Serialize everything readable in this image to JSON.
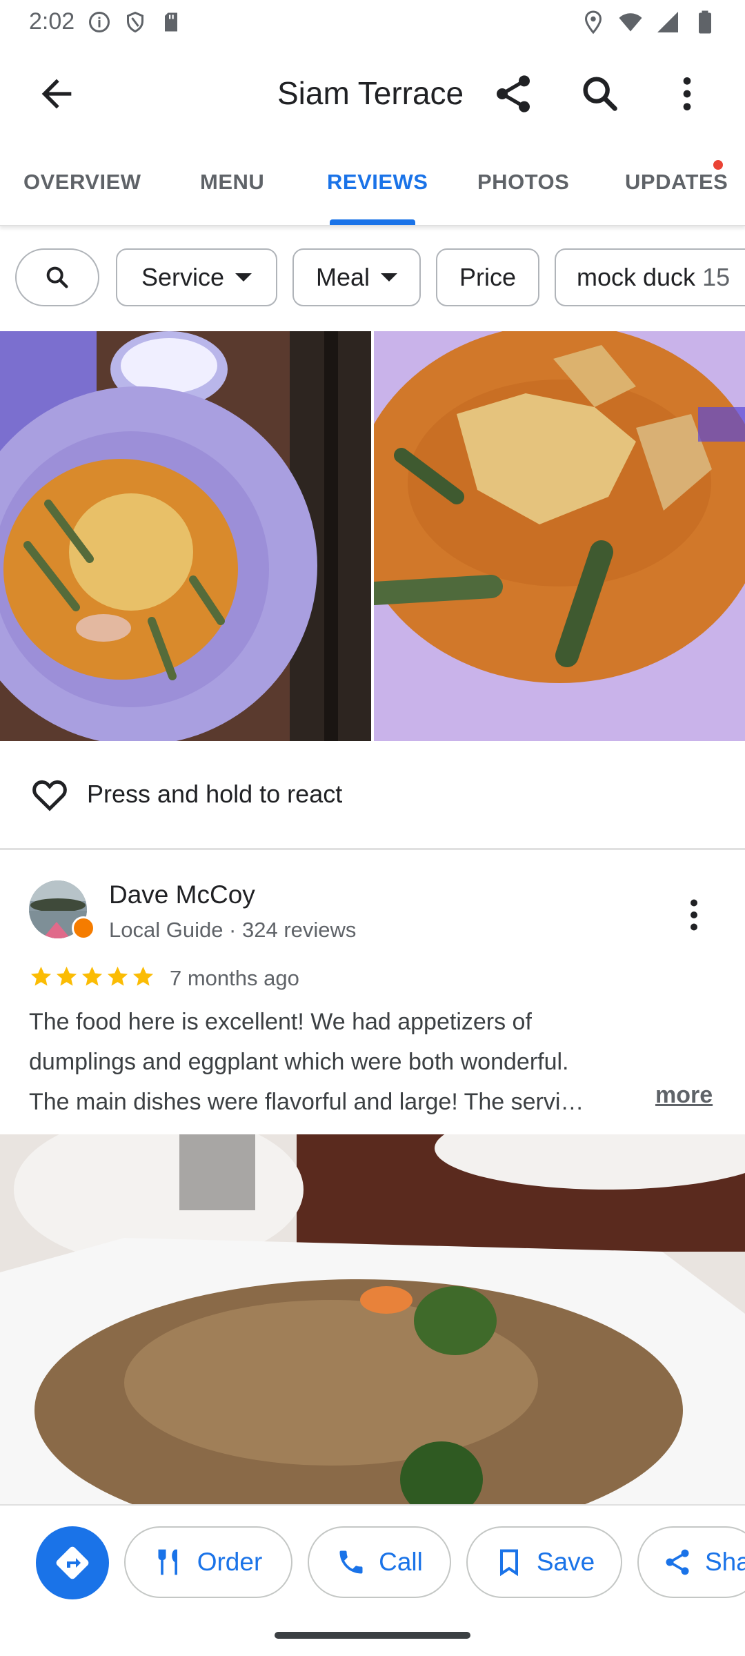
{
  "status_bar": {
    "time": "2:02",
    "left_icons": [
      "info-icon",
      "shield-icon",
      "sd-card-icon"
    ],
    "right_icons": [
      "location-icon",
      "wifi-icon",
      "signal-icon",
      "battery-icon"
    ]
  },
  "app_bar": {
    "title": "Siam Terrace",
    "icons": [
      "back-arrow-icon",
      "share-icon",
      "search-icon",
      "more-vert-icon"
    ]
  },
  "tabs": [
    {
      "label": "OVERVIEW",
      "active": false
    },
    {
      "label": "MENU",
      "active": false
    },
    {
      "label": "REVIEWS",
      "active": true
    },
    {
      "label": "PHOTOS",
      "active": false
    },
    {
      "label": "UPDATES",
      "active": false,
      "has_notification_dot": true
    }
  ],
  "filter_chips": [
    {
      "label": "Service",
      "dropdown": true
    },
    {
      "label": "Meal",
      "dropdown": true
    },
    {
      "label": "Price",
      "dropdown": false
    },
    {
      "label": "mock duck",
      "count": "15"
    }
  ],
  "react": {
    "label": "Press and hold to react"
  },
  "review": {
    "name": "Dave McCoy",
    "meta": "Local Guide · 324 reviews",
    "rating": 5,
    "time": "7 months ago",
    "lines": [
      "The food here is excellent! We had appetizers of",
      "dumplings and eggplant which were both wonderful.",
      "The main dishes were flavorful and large! The servi…"
    ],
    "more": "more"
  },
  "actions": {
    "order": "Order",
    "call": "Call",
    "save": "Save",
    "share": "Sha"
  },
  "colors": {
    "accent": "#1a73e8",
    "star": "#fbbc04",
    "notification": "#ea4335"
  }
}
